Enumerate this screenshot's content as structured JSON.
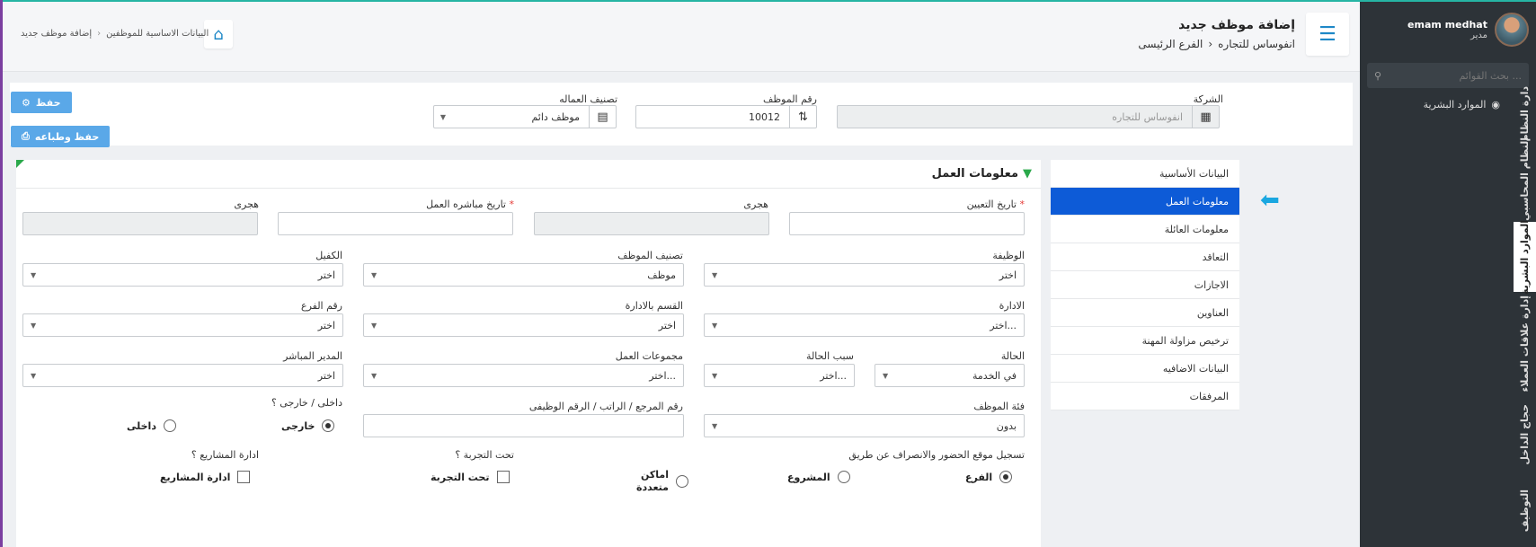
{
  "header": {
    "title": "إضافة موظف جديد",
    "company": "انفوساس للتجاره",
    "branch": "الفرع الرئيسى",
    "breadcrumb": [
      "البيانات الاساسية للموظفين",
      "إضافة موظف جديد"
    ]
  },
  "user": {
    "name": "emam medhat",
    "role": "مدير"
  },
  "sidebar": {
    "search_placeholder": "بحث القوائم ...",
    "menu_item": "الموارد البشرية",
    "vertical_tabs": [
      "دارة النظام",
      "النظام المحاسبي",
      "الموارد البشرية",
      "إدارة علاقات العملاء",
      "حجاج الداخل",
      "التوظيف"
    ]
  },
  "actions": {
    "save": "حفظ",
    "save_print": "حفظ وطباعه"
  },
  "top_form": {
    "company_label": "الشركة",
    "company_value": "انفوساس للتجاره",
    "employee_no_label": "رقم الموظف",
    "employee_no_value": "10012",
    "labor_class_label": "تصنيف العماله",
    "labor_class_value": "موظف دائم"
  },
  "tabs": [
    "البيانات الأساسية",
    "معلومات العمل",
    "معلومات العائلة",
    "التعاقد",
    "الاجازات",
    "العناوين",
    "ترخيص مزاولة المهنة",
    "البيانات الاضافيه",
    "المرفقات"
  ],
  "work": {
    "section_title": "معلومات العمل",
    "hire_date_label": "تاريخ التعيين",
    "hijri_label": "هجرى",
    "start_date_label": "تاريخ مباشره العمل",
    "hijri_label_2": "هجرى",
    "job_label": "الوظيفة",
    "job_value": "اختر",
    "emp_class_label": "تصنيف الموظف",
    "emp_class_value": "موظف",
    "sponsor_label": "الكفيل",
    "sponsor_value": "اختر",
    "dept_label": "الادارة",
    "dept_value": "اختر...",
    "section_label": "القسم بالادارة",
    "section_value": "اختر",
    "branch_no_label": "رقم الفرع",
    "branch_no_value": "اختر",
    "status_label": "الحالة",
    "status_value": "في الخدمة",
    "status_reason_label": "سبب الحالة",
    "status_reason_value": "اختر...",
    "work_groups_label": "مجموعات العمل",
    "work_groups_value": "اختر...",
    "manager_label": "المدير المباشر",
    "manager_value": "اختر",
    "emp_category_label": "فئة الموظف",
    "emp_category_value": "بدون",
    "ref_no_label": "رقم المرجع / الراتب / الرقم الوظيفى",
    "in_out_label": "داخلى / خارجى ؟",
    "external": "خارجى",
    "internal": "داخلى",
    "attendance_label": "تسجيل موقع الحضور والانصراف عن طريق",
    "att_branch": "الفرع",
    "att_project": "المشروع",
    "att_multi": "اماكن متعددة",
    "probation_label": "تحت التجربة ؟",
    "probation_check": "تحت التجربة",
    "projects_label": "ادارة المشاريع ؟",
    "projects_check": "ادارة المشاريع"
  }
}
